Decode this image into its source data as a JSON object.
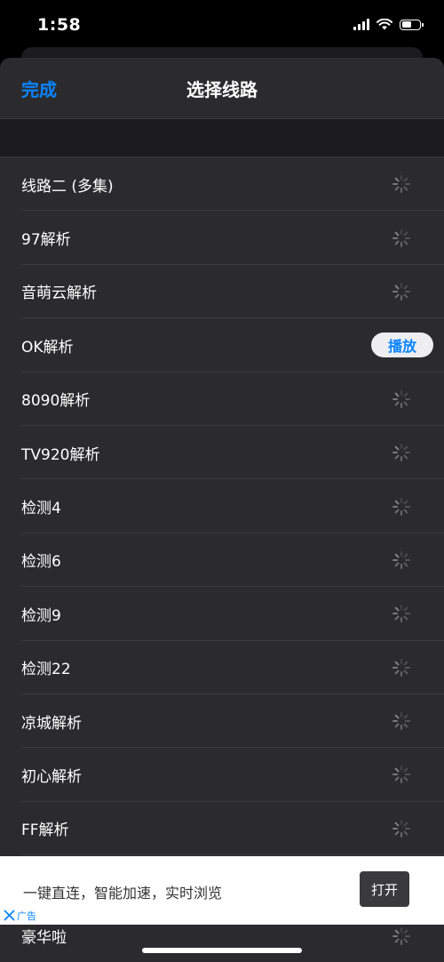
{
  "status": {
    "time": "1:58"
  },
  "nav": {
    "done_label": "完成",
    "title": "选择线路"
  },
  "routes": [
    {
      "label": "线路二 (多集)",
      "state": "loading"
    },
    {
      "label": "97解析",
      "state": "loading"
    },
    {
      "label": "音萌云解析",
      "state": "loading"
    },
    {
      "label": "OK解析",
      "state": "ready",
      "action": "播放"
    },
    {
      "label": "8090解析",
      "state": "loading"
    },
    {
      "label": "TV920解析",
      "state": "loading"
    },
    {
      "label": "检测4",
      "state": "loading"
    },
    {
      "label": "检测6",
      "state": "loading"
    },
    {
      "label": "检测9",
      "state": "loading"
    },
    {
      "label": "检测22",
      "state": "loading"
    },
    {
      "label": "凉城解析",
      "state": "loading"
    },
    {
      "label": "初心解析",
      "state": "loading"
    },
    {
      "label": "FF解析",
      "state": "loading"
    },
    {
      "label": "",
      "state": "hidden"
    },
    {
      "label": "豪华啦",
      "state": "loading"
    }
  ],
  "ad": {
    "text": "一键直连，智能加速，实时浏览",
    "open_label": "打开",
    "tag": "广告"
  },
  "colors": {
    "accent": "#0a84ff",
    "sheet_bg": "#2b2b2d",
    "separator": "#3a3a3c"
  },
  "icons": {
    "loading": "spinner-icon",
    "close": "close-icon"
  }
}
